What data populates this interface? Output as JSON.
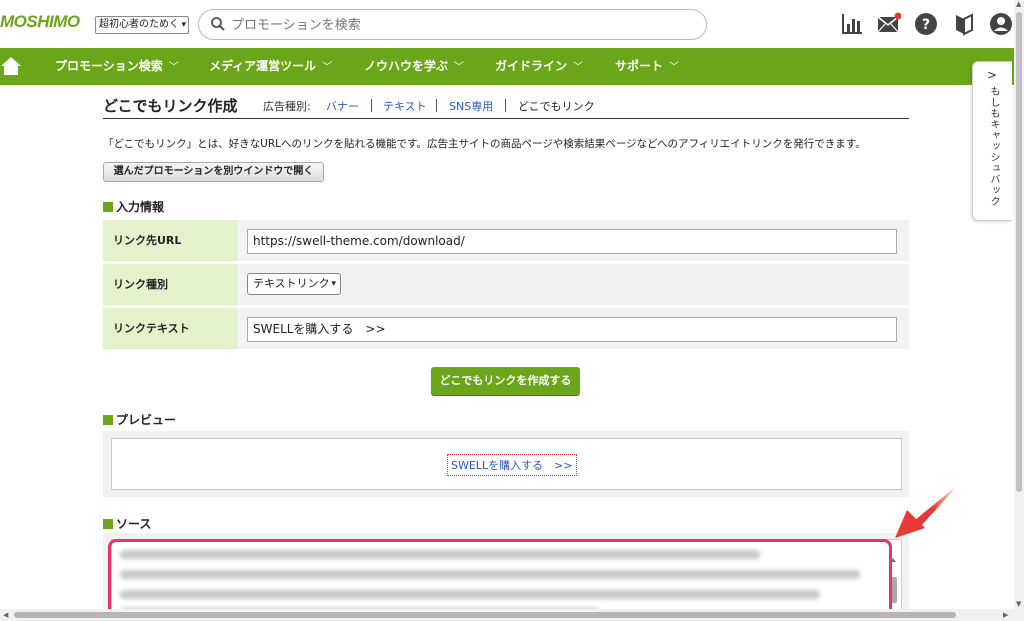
{
  "header": {
    "logo": "MOSHIMO",
    "select_value": "超初心者のためく",
    "search_placeholder": "プロモーションを検索",
    "icons": [
      "chart-icon",
      "mail-icon",
      "help-icon",
      "beginner-mark-icon",
      "user-icon"
    ],
    "mail_badge_color": "#e53935"
  },
  "nav": {
    "items": [
      {
        "label": "プロモーション検索"
      },
      {
        "label": "メディア運営ツール"
      },
      {
        "label": "ノウハウを学ぶ"
      },
      {
        "label": "ガイドライン"
      },
      {
        "label": "サポート"
      }
    ],
    "color": "#6aa51a"
  },
  "page": {
    "title": "どこでもリンク作成",
    "type_label": "広告種別:",
    "type_links": [
      "バナー",
      "テキスト",
      "SNS専用"
    ],
    "type_current": "どこでもリンク",
    "description": "「どこでもリンク」とは、好きなURLへのリンクを貼れる機能です。広告主サイトの商品ページや検索結果ページなどへのアフィリエイトリンクを発行できます。",
    "open_button": "選んだプロモーションを別ウインドウで開く"
  },
  "form": {
    "section_title": "入力情報",
    "url_label": "リンク先URL",
    "url_value": "https://swell-theme.com/download/",
    "type_label": "リンク種別",
    "type_value": "テキストリンク",
    "text_label": "リンクテキスト",
    "text_value": "SWELLを購入する　>>",
    "submit_label": "どこでもリンクを作成する"
  },
  "preview": {
    "section_title": "プレビュー",
    "link_text": "SWELLを購入する　>>"
  },
  "source": {
    "section_title": "ソース"
  },
  "side_tab": {
    "label": "もしもキャッシュバック"
  },
  "annotation": {
    "highlight_color": "#e8336b",
    "arrow_color": "#e53935"
  }
}
